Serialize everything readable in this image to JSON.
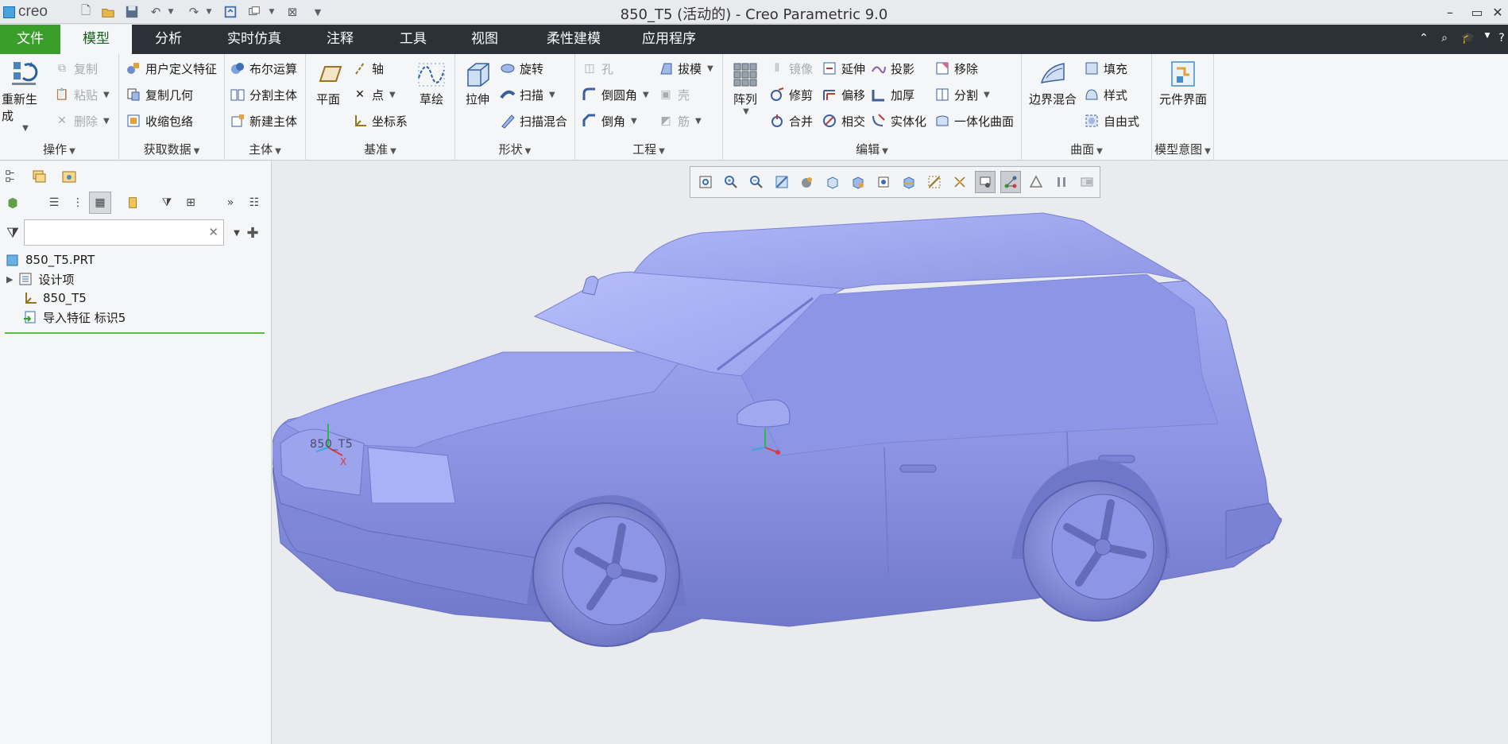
{
  "app": {
    "logo_text": "creo",
    "window_title": "850_T5 (活动的) - Creo Parametric 9.0",
    "window_controls": [
      "–",
      "▭",
      "✕"
    ]
  },
  "quick_access": [
    "new-icon",
    "open-icon",
    "save-icon",
    "undo-icon",
    "redo-icon",
    "regenerate-icon",
    "windows-icon",
    "close-window-icon",
    "customize-icon"
  ],
  "tabs": [
    {
      "label": "文件"
    },
    {
      "label": "模型"
    },
    {
      "label": "分析"
    },
    {
      "label": "实时仿真"
    },
    {
      "label": "注释"
    },
    {
      "label": "工具"
    },
    {
      "label": "视图"
    },
    {
      "label": "柔性建模"
    },
    {
      "label": "应用程序"
    }
  ],
  "ribbon": {
    "operations": {
      "label": "操作",
      "regenerate": "重新生成",
      "copy": "复制",
      "paste": "粘贴",
      "delete": "删除"
    },
    "get_data": {
      "label": "获取数据",
      "udf": "用户定义特征",
      "copy_geom": "复制几何",
      "shrinkwrap": "收缩包络"
    },
    "body": {
      "label": "主体",
      "boolean": "布尔运算",
      "split_body": "分割主体",
      "new_body": "新建主体"
    },
    "datum": {
      "label": "基准",
      "plane": "平面",
      "axis": "轴",
      "point": "点",
      "csys": "坐标系",
      "sketch": "草绘"
    },
    "shapes": {
      "label": "形状",
      "extrude": "拉伸",
      "revolve": "旋转",
      "sweep": "扫描",
      "swept_blend": "扫描混合"
    },
    "engineering": {
      "label": "工程",
      "hole": "孔",
      "round": "倒圆角",
      "chamfer": "倒角",
      "draft": "拔模",
      "shell": "壳",
      "rib": "筋"
    },
    "editing": {
      "label": "编辑",
      "pattern": "阵列",
      "mirror": "镜像",
      "trim": "修剪",
      "merge": "合并",
      "extend": "延伸",
      "offset": "偏移",
      "intersect": "相交",
      "project": "投影",
      "thicken": "加厚",
      "solidify": "实体化",
      "remove": "移除",
      "split": "分割",
      "unify": "一体化曲面"
    },
    "surfaces": {
      "label": "曲面",
      "boundary_blend": "边界混合",
      "fill": "填充",
      "style": "样式",
      "freestyle": "自由式"
    },
    "intent": {
      "label": "模型意图",
      "component_interface": "元件界面"
    }
  },
  "model_tree": {
    "filter_placeholder": "",
    "items": [
      {
        "label": "850_T5.PRT"
      },
      {
        "label": "设计项"
      },
      {
        "label": "850_T5"
      },
      {
        "label": "导入特征 标识5"
      }
    ]
  },
  "viewport": {
    "csys_label": "850_T5",
    "csys_axis_x": "X",
    "model_color": "#8f97e8",
    "background": "#e9ebee"
  },
  "colors": {
    "tabbar": "#2b3137",
    "file_tab": "#3a9e2a",
    "accent_green": "#5dbb3f"
  }
}
